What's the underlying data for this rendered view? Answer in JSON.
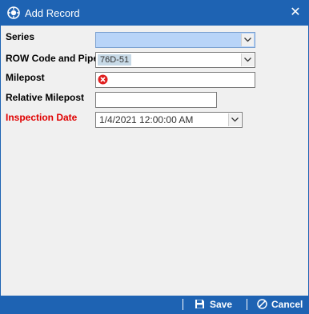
{
  "window": {
    "title": "Add Record",
    "close_glyph": "✕"
  },
  "form": {
    "series": {
      "label": "Series",
      "value": ""
    },
    "row_code": {
      "label": "ROW Code and Pipe",
      "chip": "76D-51"
    },
    "milepost": {
      "label": "Milepost",
      "value": ""
    },
    "relative_milepost": {
      "label": "Relative Milepost",
      "value": ""
    },
    "inspection_date": {
      "label": "Inspection Date",
      "value": "1/4/2021 12:00:00 AM"
    }
  },
  "footer": {
    "save_label": "Save",
    "cancel_label": "Cancel"
  },
  "colors": {
    "accent": "#1e63b3",
    "required": "#e00000",
    "highlight": "#b8d4f8",
    "error": "#e02020"
  },
  "icons": {
    "title": "app-logo-icon",
    "close": "close-icon",
    "dropdown": "chevron-down-icon",
    "error": "error-icon",
    "save": "floppy-disk-icon",
    "cancel": "cancel-icon"
  }
}
